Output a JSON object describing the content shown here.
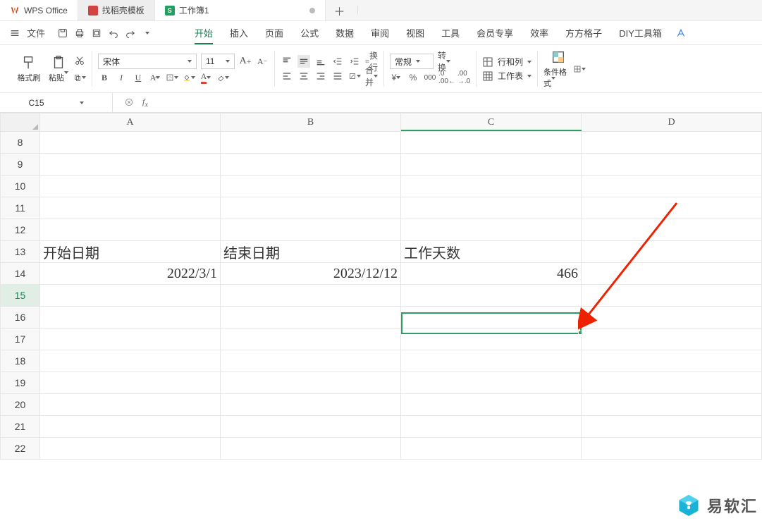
{
  "title_tabs": {
    "wps": "WPS Office",
    "tpl": "找稻壳模板",
    "doc": "工作簿1"
  },
  "qat": {
    "file": "文件"
  },
  "menu": {
    "items": [
      "开始",
      "插入",
      "页面",
      "公式",
      "数据",
      "审阅",
      "视图",
      "工具",
      "会员专享",
      "效率",
      "方方格子",
      "DIY工具箱"
    ],
    "active_index": 0
  },
  "ribbon": {
    "format_painter": "格式刷",
    "paste": "粘贴",
    "font_name": "宋体",
    "font_size": "11",
    "bold": "B",
    "italic": "I",
    "underline": "U",
    "wrap": "换行",
    "merge": "合并",
    "number_format": "常规",
    "convert": "转换",
    "rowcol": "行和列",
    "worksheet": "工作表",
    "cond_format": "条件格式"
  },
  "namebox": "C15",
  "columns": [
    "A",
    "B",
    "C",
    "D"
  ],
  "rows": [
    "8",
    "9",
    "10",
    "11",
    "12",
    "13",
    "14",
    "15",
    "16",
    "17",
    "18",
    "19",
    "20",
    "21",
    "22"
  ],
  "active_row_index": 7,
  "cells": {
    "A13": "开始日期",
    "B13": "结束日期",
    "C13": "工作天数",
    "A14": "2022/3/1",
    "B14": "2023/12/12",
    "C14": "466"
  },
  "watermark": "易软汇"
}
